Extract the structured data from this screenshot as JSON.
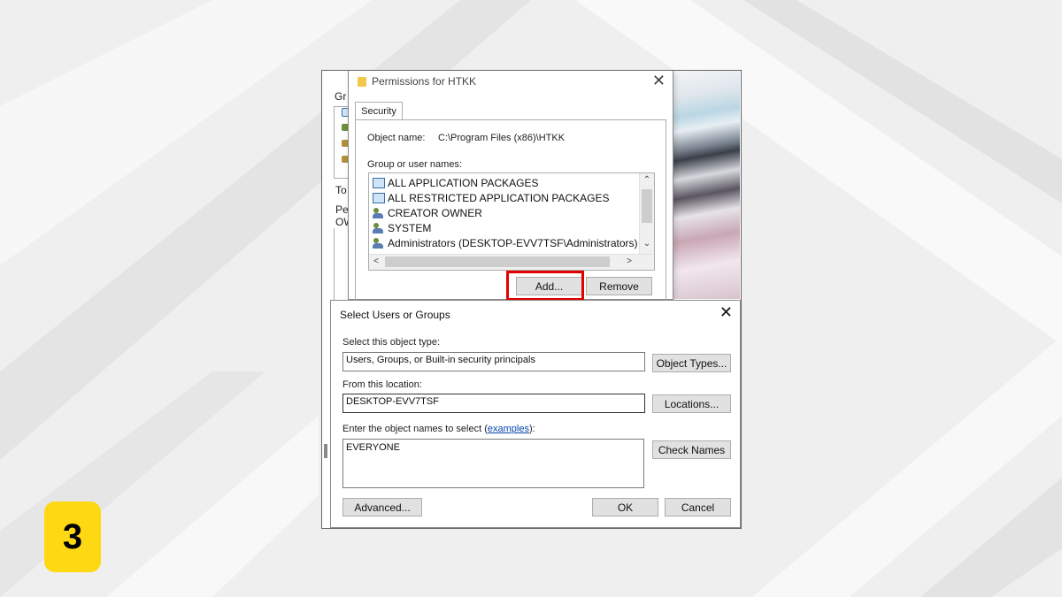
{
  "step_badge": "3",
  "background_window": {
    "fragments": [
      "Gr",
      "To",
      "Pe",
      "OW"
    ]
  },
  "permissions_dialog": {
    "title": "Permissions for HTKK",
    "close_glyph": "✕",
    "tab": "Security",
    "object_name_label": "Object name:",
    "object_name_value": "C:\\Program Files (x86)\\HTKK",
    "group_label": "Group or user names:",
    "principals": [
      {
        "icon": "package-icon",
        "name": "ALL APPLICATION PACKAGES"
      },
      {
        "icon": "package-icon",
        "name": "ALL RESTRICTED APPLICATION PACKAGES"
      },
      {
        "icon": "user-group-icon",
        "name": "CREATOR OWNER"
      },
      {
        "icon": "user-group-icon",
        "name": "SYSTEM"
      },
      {
        "icon": "user-group-icon",
        "name": "Administrators (DESKTOP-EVV7TSF\\Administrators)"
      }
    ],
    "add_button": "Add...",
    "remove_button": "Remove",
    "highlight_color": "#e00000"
  },
  "select_dialog": {
    "title": "Select Users or Groups",
    "close_glyph": "✕",
    "object_type_label": "Select this object type:",
    "object_type_value": "Users, Groups, or Built-in security principals",
    "object_types_button": "Object Types...",
    "location_label": "From this location:",
    "location_value": "DESKTOP-EVV7TSF",
    "locations_button": "Locations...",
    "enter_names_label_prefix": "Enter the object names to select (",
    "examples_link": "examples",
    "enter_names_label_suffix": "):",
    "names_value": "EVERYONE",
    "check_names_button": "Check Names",
    "advanced_button": "Advanced...",
    "ok_button": "OK",
    "cancel_button": "Cancel"
  },
  "colors": {
    "badge": "#ffd814",
    "link": "#0645ad"
  }
}
